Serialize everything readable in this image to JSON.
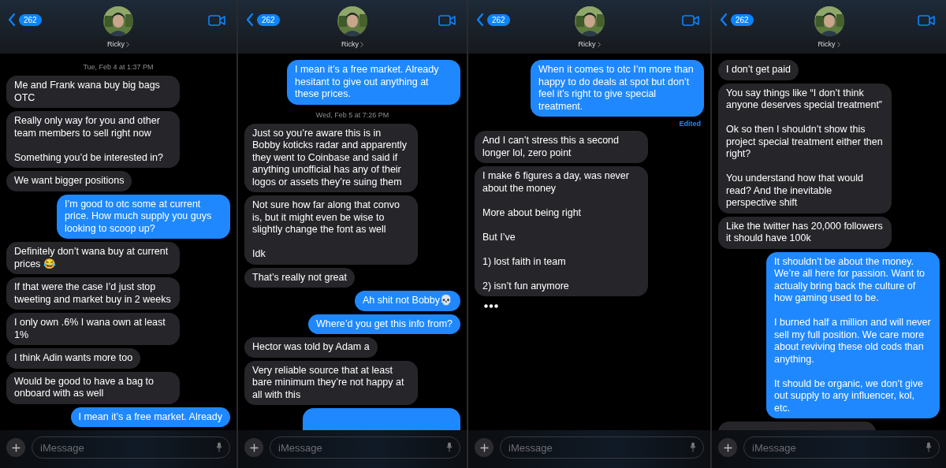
{
  "screens": [
    {
      "header": {
        "badge": "262",
        "name": "Ricky"
      },
      "messages": [
        {
          "kind": "timestamp",
          "text": "Tue, Feb 4 at 1:37 PM"
        },
        {
          "kind": "received",
          "text": "Me and Frank wana buy big bags OTC"
        },
        {
          "kind": "received",
          "text": "Really only way for you and other team members to sell right now\n\nSomething you’d be interested in?"
        },
        {
          "kind": "received",
          "text": "We want bigger positions"
        },
        {
          "kind": "sent",
          "text": "I’m good to otc some at current price. How much supply you guys looking to scoop up?"
        },
        {
          "kind": "received",
          "text": "Definitely don’t wana buy at current prices 😂"
        },
        {
          "kind": "received",
          "text": "If that were the case I’d just stop tweeting and market buy in 2 weeks"
        },
        {
          "kind": "received",
          "text": "I only own .6% I wana own at least 1%"
        },
        {
          "kind": "received",
          "text": "I think Adin wants more too"
        },
        {
          "kind": "received",
          "text": "Would be good to have a bag to onboard with as well"
        },
        {
          "kind": "sent",
          "text": "I mean it’s a free market. Already"
        }
      ],
      "composer": {
        "placeholder": "iMessage"
      }
    },
    {
      "header": {
        "badge": "262",
        "name": "Ricky"
      },
      "messages": [
        {
          "kind": "sent",
          "text": "I mean it’s a free market. Already hesitant to give out anything at these prices."
        },
        {
          "kind": "timestamp",
          "text": "Wed, Feb 5 at 7:26 PM"
        },
        {
          "kind": "received",
          "text": "Just so you’re aware this is in Bobby koticks radar and apparently they went to Coinbase and said if anything unofficial has any of their logos or assets they’re suing them"
        },
        {
          "kind": "received",
          "text": "Not sure how far along that convo is, but it might even be wise to slightly change the font as well\n\nIdk"
        },
        {
          "kind": "received",
          "text": "That’s really not great"
        },
        {
          "kind": "sent",
          "text": "Ah shit not Bobby💀"
        },
        {
          "kind": "sent",
          "text": "Where’d you get this info from?"
        },
        {
          "kind": "received",
          "text": "Hector was told by Adam a"
        },
        {
          "kind": "received",
          "text": "Very reliable source that at least bare minimum they’re not happy at all with this"
        },
        {
          "kind": "sent"
        }
      ],
      "composer": {
        "placeholder": "iMessage"
      }
    },
    {
      "header": {
        "badge": "262",
        "name": "Ricky"
      },
      "messages": [
        {
          "kind": "sent",
          "text": "When it comes to otc I’m more than happy to do deals at spot but don’t feel it’s right to give special treatment."
        },
        {
          "kind": "edited",
          "text": "Edited"
        },
        {
          "kind": "received",
          "text": "And I can’t stress this a second longer lol, zero point"
        },
        {
          "kind": "received",
          "text": "I make 6 figures a day, was never about the money\n\nMore about being right\n\nBut I’ve\n\n1) lost faith in team\n\n2) isn’t fun anymore"
        },
        {
          "kind": "typing"
        }
      ],
      "composer": {
        "placeholder": "iMessage"
      }
    },
    {
      "header": {
        "badge": "262",
        "name": "Ricky"
      },
      "messages": [
        {
          "kind": "received",
          "text": "I don’t get paid"
        },
        {
          "kind": "received",
          "text": "You say things like “I don’t think anyone deserves special treatment”\n\nOk so then I shouldn’t show this project special treatment either then right?\n\nYou understand how that would read? And the inevitable perspective shift"
        },
        {
          "kind": "received",
          "text": "Like the twitter has 20,000 followers it should have 100k"
        },
        {
          "kind": "sent",
          "text": "It shouldn’t be about the money. We’re all here for passion. Want to actually bring back the culture of how gaming used to be.\n\nI burned half a million and will never sell my full position. We care more about reviving these old cods than anything.\n\nIt should be organic, we don’t give out supply to any influencer, kol, etc."
        },
        {
          "kind": "received"
        }
      ],
      "composer": {
        "placeholder": "iMessage"
      }
    }
  ]
}
